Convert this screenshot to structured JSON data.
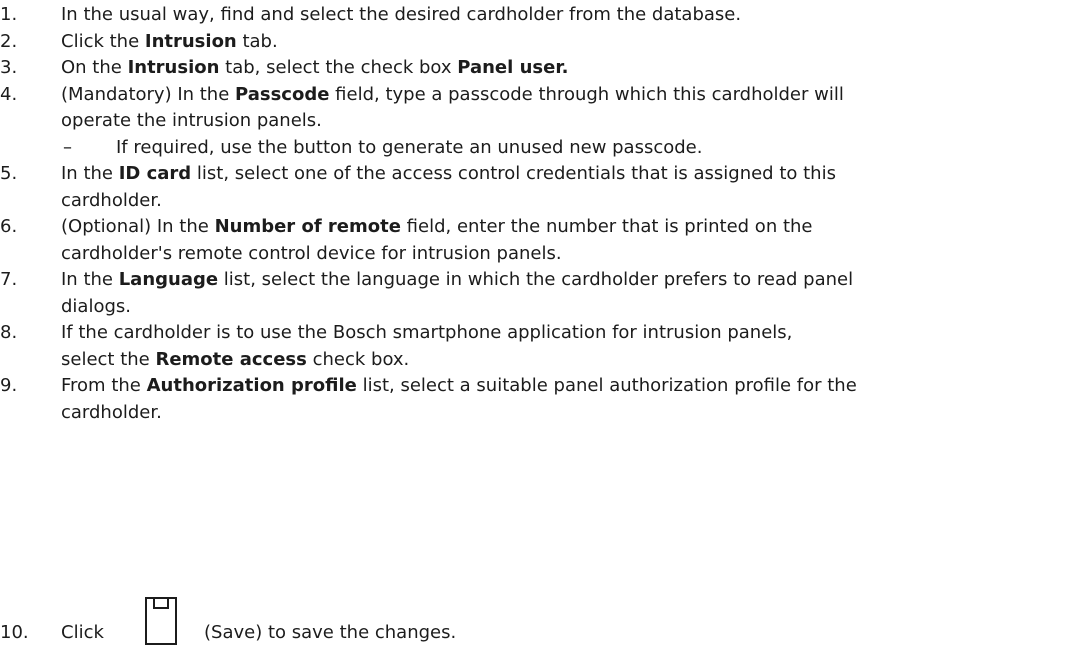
{
  "steps": [
    {
      "number": "1.",
      "segments": [
        {
          "text": "In the usual way, find and select the desired cardholder from the database.",
          "bold": false
        }
      ]
    },
    {
      "number": "2.",
      "segments": [
        {
          "text": "Click the ",
          "bold": false
        },
        {
          "text": "Intrusion",
          "bold": true
        },
        {
          "text": " tab.",
          "bold": false
        }
      ]
    },
    {
      "number": "3.",
      "segments": [
        {
          "text": "On the ",
          "bold": false
        },
        {
          "text": "Intrusion",
          "bold": true
        },
        {
          "text": " tab, select the check box ",
          "bold": false
        },
        {
          "text": "Panel user.",
          "bold": true
        }
      ]
    },
    {
      "number": "4.",
      "lines": [
        [
          {
            "text": "(Mandatory) In the ",
            "bold": false
          },
          {
            "text": "Passcode",
            "bold": true
          },
          {
            "text": " field, type a passcode through which this cardholder will",
            "bold": false
          }
        ],
        [
          {
            "text": "operate the intrusion panels.",
            "bold": false
          }
        ]
      ],
      "sub": {
        "marker": "–",
        "text": "If required, use the button to generate an unused new passcode."
      }
    },
    {
      "number": "5.",
      "lines": [
        [
          {
            "text": "In the ",
            "bold": false
          },
          {
            "text": "ID card",
            "bold": true
          },
          {
            "text": " list, select one of the access control credentials that is assigned to this",
            "bold": false
          }
        ],
        [
          {
            "text": "cardholder.",
            "bold": false
          }
        ]
      ]
    },
    {
      "number": "6.",
      "lines": [
        [
          {
            "text": "(Optional) In the ",
            "bold": false
          },
          {
            "text": "Number of remote",
            "bold": true
          },
          {
            "text": " field, enter the number that is printed on the",
            "bold": false
          }
        ],
        [
          {
            "text": "cardholder's remote control device for intrusion panels.",
            "bold": false
          }
        ]
      ]
    },
    {
      "number": "7.",
      "lines": [
        [
          {
            "text": "In the ",
            "bold": false
          },
          {
            "text": "Language",
            "bold": true
          },
          {
            "text": " list, select the language in which the cardholder prefers to read panel",
            "bold": false
          }
        ],
        [
          {
            "text": "dialogs.",
            "bold": false
          }
        ]
      ]
    },
    {
      "number": "8.",
      "lines": [
        [
          {
            "text": "If the cardholder is to use the Bosch smartphone application for intrusion panels,",
            "bold": false
          }
        ],
        [
          {
            "text": "select the ",
            "bold": false
          },
          {
            "text": "Remote access",
            "bold": true
          },
          {
            "text": " check box.",
            "bold": false
          }
        ]
      ]
    },
    {
      "number": "9.",
      "lines": [
        [
          {
            "text": "From the ",
            "bold": false
          },
          {
            "text": "Authorization profile",
            "bold": true
          },
          {
            "text": " list, select a suitable panel authorization profile for the",
            "bold": false
          }
        ],
        [
          {
            "text": "cardholder.",
            "bold": false
          }
        ]
      ]
    }
  ],
  "final_step": {
    "number": "10.",
    "before_icon": "Click",
    "icon": "save-icon",
    "after_icon": "(Save) to save the changes."
  }
}
